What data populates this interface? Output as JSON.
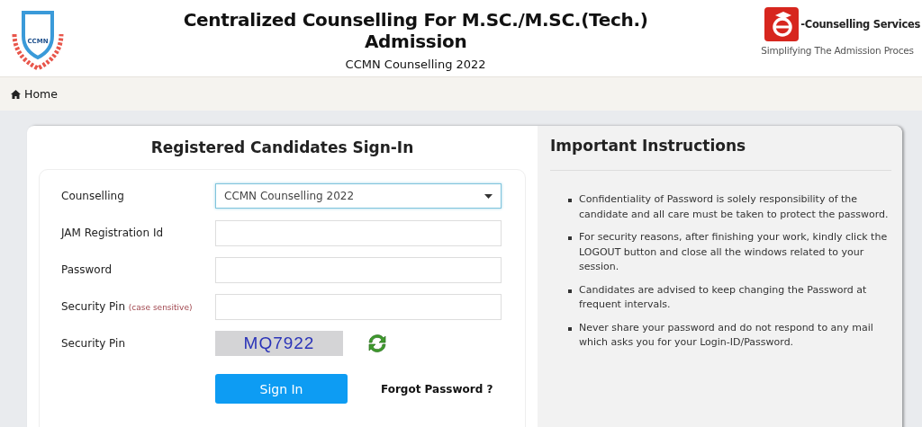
{
  "header": {
    "logo_text": "CCMN",
    "title_line1": "Centralized Counselling For M.SC./M.SC.(Tech.)",
    "title_line2": "Admission",
    "subtitle": "CCMN Counselling 2022",
    "brand_name": "-Counselling Services",
    "brand_tagline": "Simplifying The Admission Proces"
  },
  "nav": {
    "items": [
      {
        "label": "Home",
        "selected": false
      }
    ]
  },
  "signin": {
    "title": "Registered Candidates Sign-In",
    "fields": [
      {
        "kind": "select",
        "label": "Counselling",
        "value": "CCMN Counselling 2022",
        "focused": true
      },
      {
        "kind": "input",
        "label": "JAM Registration Id",
        "focused": false
      },
      {
        "kind": "input",
        "label": "Password",
        "focused": false
      },
      {
        "kind": "input",
        "label": "Security Pin",
        "note": "(case sensitive)",
        "focused": false
      },
      {
        "kind": "captcha",
        "label": "Security Pin",
        "value": "MQ7922"
      }
    ],
    "button": "Sign In",
    "forgot_link": "Forgot Password ?"
  },
  "instructions": {
    "title": "Important Instructions",
    "items": [
      "Confidentiality of Password is solely responsibility of the candidate and all care must be taken to protect the password.",
      "For security reasons, after finishing your work, kindly click the LOGOUT button and close all the windows related to your session.",
      "Candidates are advised to keep changing the Password at frequent intervals.",
      "Never share your password and do not respond to any mail which asks you for your Login-ID/Password."
    ]
  }
}
